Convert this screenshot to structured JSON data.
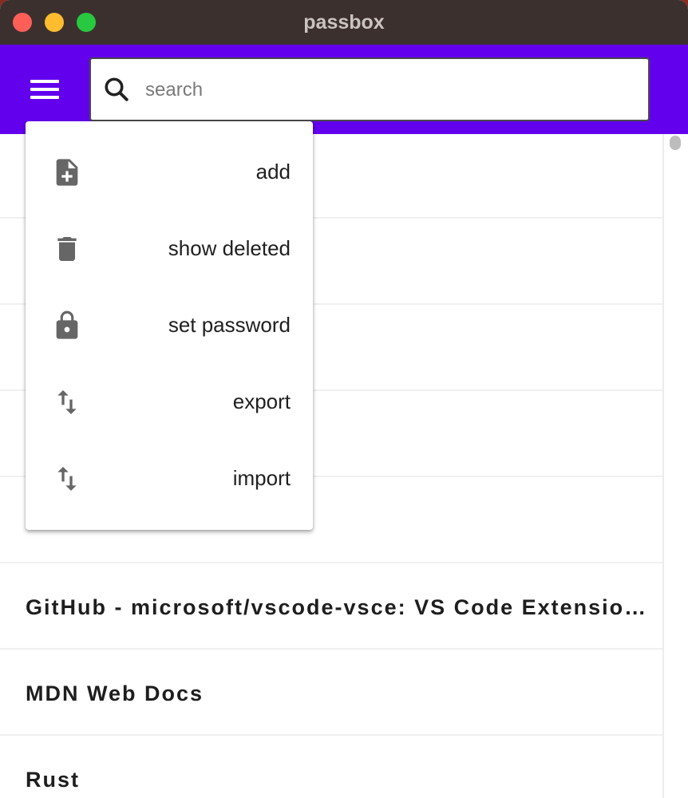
{
  "window": {
    "title": "passbox",
    "traffic_colors": {
      "close": "#ff5f57",
      "minimize": "#febc2e",
      "zoom": "#28c840"
    }
  },
  "theme": {
    "accent": "#6200ee",
    "icon_color": "#666666"
  },
  "search": {
    "placeholder": "search",
    "value": ""
  },
  "menu": {
    "items": [
      {
        "label": "add",
        "icon": "file-add-icon"
      },
      {
        "label": "show deleted",
        "icon": "trash-icon"
      },
      {
        "label": "set password",
        "icon": "lock-icon"
      },
      {
        "label": "export",
        "icon": "swap-vertical-icon"
      },
      {
        "label": "import",
        "icon": "swap-vertical-icon"
      }
    ]
  },
  "list": {
    "items": [
      {
        "label": ""
      },
      {
        "label": ""
      },
      {
        "label": ""
      },
      {
        "label": ""
      },
      {
        "label": ""
      },
      {
        "label": "GitHub - microsoft/vscode-vsce: VS Code Extension Manager"
      },
      {
        "label": "MDN Web Docs"
      },
      {
        "label": "Rust"
      }
    ]
  }
}
